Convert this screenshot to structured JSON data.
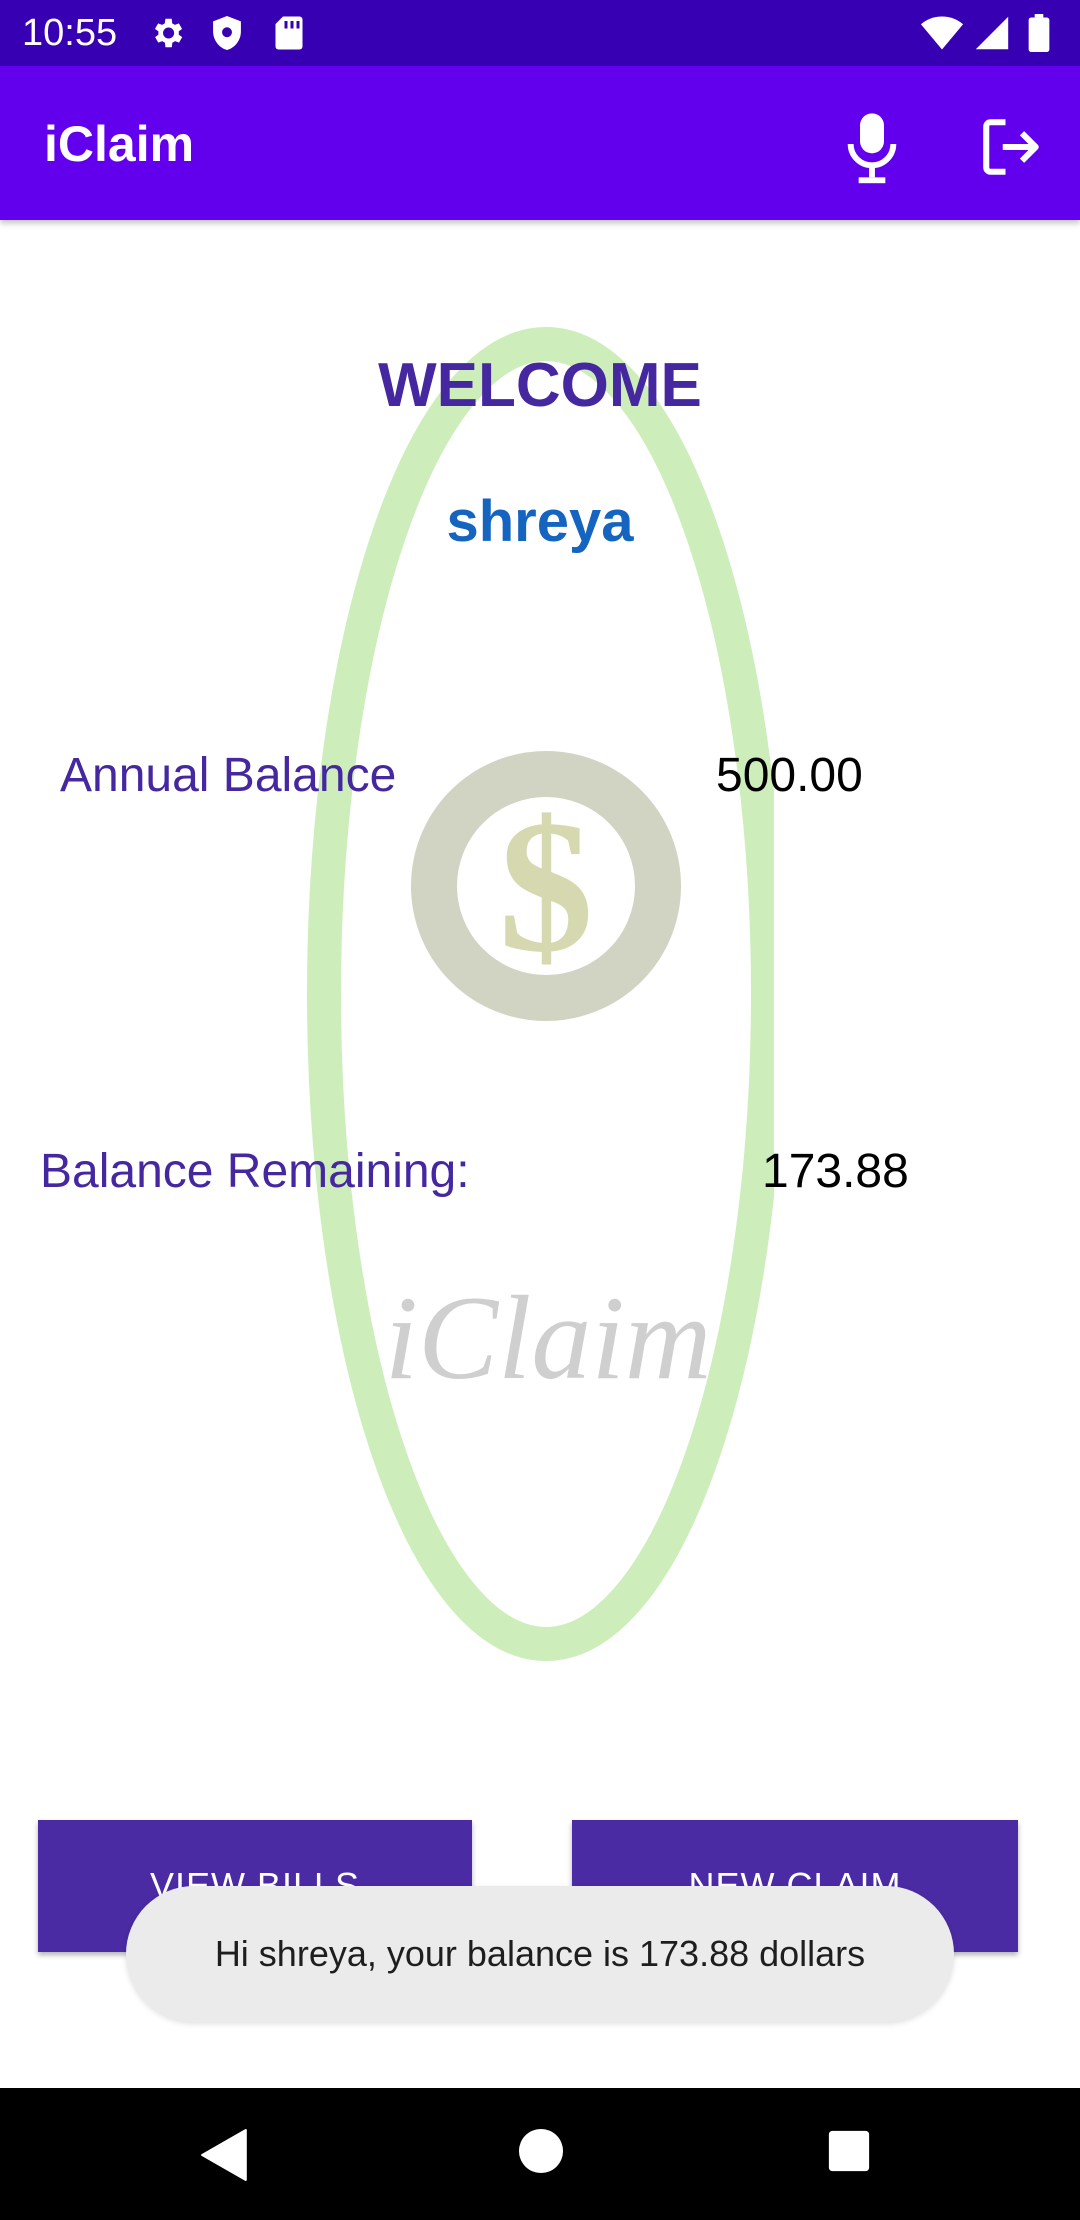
{
  "status_bar": {
    "time": "10:55",
    "left_icons": [
      "settings-icon",
      "shield-icon",
      "sd-card-icon"
    ],
    "right_icons": [
      "wifi-icon",
      "signal-icon",
      "battery-icon"
    ]
  },
  "app_bar": {
    "title": "iClaim",
    "actions": [
      "microphone-icon",
      "logout-icon"
    ],
    "color": "#6200ee"
  },
  "welcome": {
    "title": "WELCOME",
    "user_name": "shreya"
  },
  "balances": {
    "annual_label": "Annual Balance",
    "annual_value": "500.00",
    "remaining_label": "Balance Remaining:",
    "remaining_value": "173.88"
  },
  "buttons": {
    "view_bills": "VIEW BILLS",
    "new_claim": "NEW CLAIM",
    "color": "#4a2ba3"
  },
  "toast": {
    "message": "Hi shreya, your balance is 173.88 dollars"
  },
  "watermark": {
    "logo_text": "iClaim"
  },
  "nav_bar": {
    "buttons": [
      "back-icon",
      "home-icon",
      "recents-icon"
    ]
  }
}
